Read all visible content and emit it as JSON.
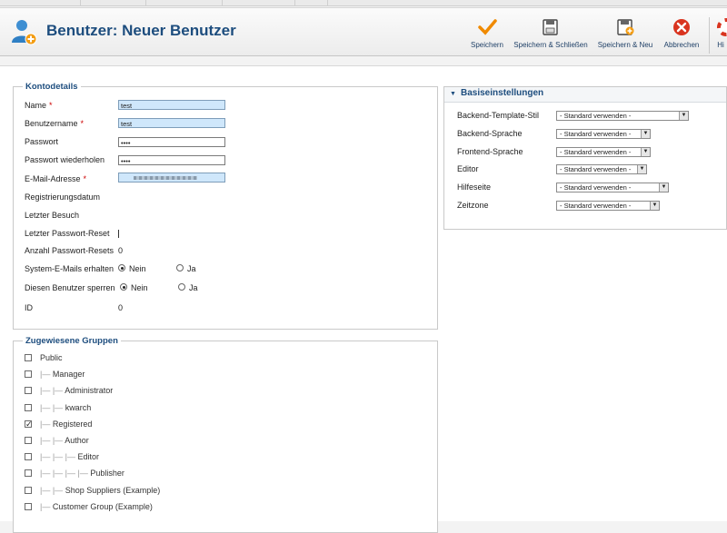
{
  "toolbar": {
    "title": "Benutzer: Neuer Benutzer",
    "buttons": {
      "save": "Speichern",
      "save_close": "Speichern & Schließen",
      "save_new": "Speichern & Neu",
      "cancel": "Abbrechen",
      "help": "Hi"
    }
  },
  "account": {
    "legend": "Kontodetails",
    "name_label": "Name",
    "name_value": "test",
    "username_label": "Benutzername",
    "username_value": "test",
    "password_label": "Passwort",
    "password_value": "••••",
    "password2_label": "Passwort wiederholen",
    "password2_value": "••••",
    "email_label": "E-Mail-Adresse",
    "registered_label": "Registrierungsdatum",
    "lastvisit_label": "Letzter Besuch",
    "lastreset_label": "Letzter Passwort-Reset",
    "resetcount_label": "Anzahl Passwort-Resets",
    "resetcount_value": "0",
    "sysmail_label": "System-E-Mails erhalten",
    "block_label": "Diesen Benutzer sperren",
    "no": "Nein",
    "yes": "Ja",
    "id_label": "ID",
    "id_value": "0",
    "required_mark": "*"
  },
  "groups": {
    "legend": "Zugewiesene Gruppen",
    "items": [
      {
        "prefix": "",
        "label": "Public",
        "checked": false
      },
      {
        "prefix": "|— ",
        "label": "Manager",
        "checked": false
      },
      {
        "prefix": "|— |— ",
        "label": "Administrator",
        "checked": false
      },
      {
        "prefix": "|— |— ",
        "label": "kwarch",
        "checked": false
      },
      {
        "prefix": "|— ",
        "label": "Registered",
        "checked": true
      },
      {
        "prefix": "|— |— ",
        "label": "Author",
        "checked": false
      },
      {
        "prefix": "|— |— |— ",
        "label": "Editor",
        "checked": false
      },
      {
        "prefix": "|— |— |— |— ",
        "label": "Publisher",
        "checked": false
      },
      {
        "prefix": "|— |— ",
        "label": "Shop Suppliers (Example)",
        "checked": false
      },
      {
        "prefix": "|— ",
        "label": "Customer Group (Example)",
        "checked": false
      }
    ]
  },
  "basic": {
    "title": "Basiseinstellungen",
    "rows": [
      {
        "label": "Backend-Template-Stil",
        "value": "- Standard verwenden -"
      },
      {
        "label": "Backend-Sprache",
        "value": "- Standard verwenden -"
      },
      {
        "label": "Frontend-Sprache",
        "value": "- Standard verwenden -"
      },
      {
        "label": "Editor",
        "value": "- Standard verwenden -"
      },
      {
        "label": "Hilfeseite",
        "value": "- Standard verwenden -"
      },
      {
        "label": "Zeitzone",
        "value": "- Standard verwenden -"
      }
    ]
  },
  "colors": {
    "title": "#1d4d7e",
    "input_highlight": "#cfe7fb",
    "required": "#cc0000"
  }
}
